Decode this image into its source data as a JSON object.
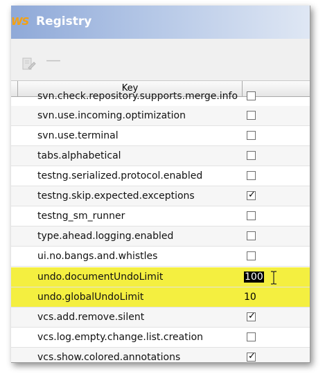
{
  "window": {
    "title": "Registry",
    "app_icon": "WS"
  },
  "toolbar": {
    "edit_icon": "edit-icon",
    "remove_icon": "minus-icon",
    "remove_label": "—"
  },
  "table": {
    "columns": [
      "Key",
      ""
    ],
    "rows": [
      {
        "key": "svn.check.repository.supports.merge.info",
        "type": "checkbox",
        "checked": false
      },
      {
        "key": "svn.use.incoming.optimization",
        "type": "checkbox",
        "checked": false
      },
      {
        "key": "svn.use.terminal",
        "type": "checkbox",
        "checked": false
      },
      {
        "key": "tabs.alphabetical",
        "type": "checkbox",
        "checked": false
      },
      {
        "key": "testng.serialized.protocol.enabled",
        "type": "checkbox",
        "checked": false
      },
      {
        "key": "testng.skip.expected.exceptions",
        "type": "checkbox",
        "checked": true
      },
      {
        "key": "testng_sm_runner",
        "type": "checkbox",
        "checked": false
      },
      {
        "key": "type.ahead.logging.enabled",
        "type": "checkbox",
        "checked": false
      },
      {
        "key": "ui.no.bangs.and.whistles",
        "type": "checkbox",
        "checked": false
      },
      {
        "key": "undo.documentUndoLimit",
        "type": "value",
        "value": "100",
        "highlight": true,
        "editing": true
      },
      {
        "key": "undo.globalUndoLimit",
        "type": "value",
        "value": "10",
        "highlight": true
      },
      {
        "key": "vcs.add.remove.silent",
        "type": "checkbox",
        "checked": true
      },
      {
        "key": "vcs.log.empty.change.list.creation",
        "type": "checkbox",
        "checked": false
      },
      {
        "key": "vcs.show.colored.annotations",
        "type": "checkbox",
        "checked": true
      }
    ]
  },
  "colors": {
    "highlight": "#f4ef40",
    "titlebar": "#8fa9d8"
  }
}
